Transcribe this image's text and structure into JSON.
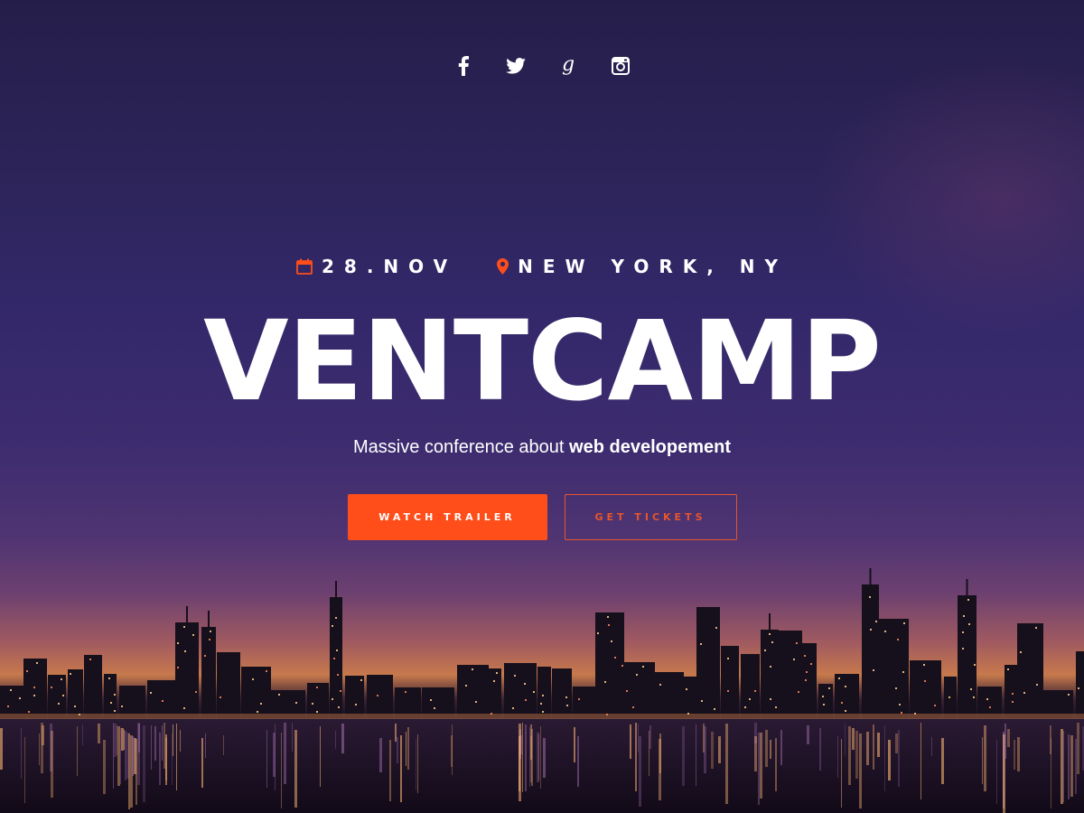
{
  "social": [
    {
      "name": "facebook",
      "icon": "facebook-icon"
    },
    {
      "name": "twitter",
      "icon": "twitter-icon"
    },
    {
      "name": "google-plus",
      "icon": "google-plus-icon"
    },
    {
      "name": "instagram",
      "icon": "instagram-icon"
    }
  ],
  "event": {
    "date": "28.NOV",
    "date_icon": "calendar-icon",
    "location": "NEW YORK, NY",
    "location_icon": "map-pin-icon"
  },
  "hero": {
    "title": "VENTCAMP",
    "subtitle_prefix": "Massive conference about ",
    "subtitle_bold": "web developement"
  },
  "cta": {
    "primary_label": "WATCH TRAILER",
    "secondary_label": "GET TICKETS"
  },
  "colors": {
    "accent": "#ff4e1a",
    "text": "#ffffff",
    "sky_top": "#251d49",
    "sky_mid": "#3d2c6f",
    "horizon": "#c7794c"
  }
}
